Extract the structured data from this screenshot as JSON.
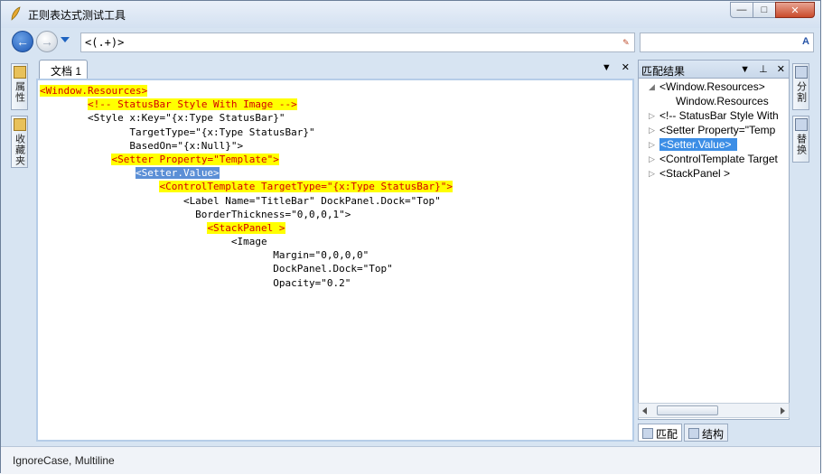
{
  "window": {
    "title": "正则表达式测试工具",
    "controls": {
      "minimize": "—",
      "maximize": "□",
      "close": "✕"
    }
  },
  "toolbar": {
    "back_label": "←",
    "forward_label": "→",
    "regex_value": "<(.+)>",
    "replace_value": ""
  },
  "left_sidebar": {
    "tabs": [
      {
        "label": "属性",
        "icon": "properties-icon"
      },
      {
        "label": "收藏夹",
        "icon": "favorites-icon"
      }
    ]
  },
  "document": {
    "tab_label": "文档 1",
    "tab_menu": "▼",
    "tab_close": "✕",
    "lines": [
      [
        {
          "t": "<Window.Resources>",
          "h": "y"
        }
      ],
      [
        {
          "t": "        "
        },
        {
          "t": "<!-- StatusBar Style With Image -->",
          "h": "y"
        }
      ],
      [
        {
          "t": "        <Style x:Key=\"{x:Type StatusBar}\""
        }
      ],
      [
        {
          "t": "               TargetType=\"{x:Type StatusBar}\""
        }
      ],
      [
        {
          "t": "               BasedOn=\"{x:Null}\">"
        }
      ],
      [
        {
          "t": "            "
        },
        {
          "t": "<Setter Property=\"Template\">",
          "h": "y"
        }
      ],
      [
        {
          "t": "                "
        },
        {
          "t": "<Setter.Value>",
          "h": "b"
        }
      ],
      [
        {
          "t": "                    "
        },
        {
          "t": "<ControlTemplate TargetType=\"{x:Type StatusBar}\">",
          "h": "y"
        }
      ],
      [
        {
          "t": "                        <Label Name=\"TitleBar\" DockPanel.Dock=\"Top\""
        }
      ],
      [
        {
          "t": "                          BorderThickness=\"0,0,0,1\">"
        }
      ],
      [
        {
          "t": "                            "
        },
        {
          "t": "<StackPanel >",
          "h": "y"
        }
      ],
      [
        {
          "t": "                                <Image"
        }
      ],
      [
        {
          "t": "                                       Margin=\"0,0,0,0\""
        }
      ],
      [
        {
          "t": "                                       DockPanel.Dock=\"Top\""
        }
      ],
      [
        {
          "t": "                                       Opacity=\"0.2\""
        }
      ]
    ]
  },
  "match_panel": {
    "title": "匹配结果",
    "controls": {
      "menu": "▼",
      "pin": "⊥",
      "close": "✕"
    },
    "results": [
      {
        "label": "<Window.Resources>",
        "expanded": true,
        "selected": false
      },
      {
        "label": "Window.Resources",
        "child": true,
        "selected": false
      },
      {
        "label": "<!-- StatusBar Style With",
        "expanded": false,
        "selected": false
      },
      {
        "label": "<Setter Property=\"Temp",
        "expanded": false,
        "selected": false
      },
      {
        "label": "<Setter.Value>",
        "expanded": false,
        "selected": true
      },
      {
        "label": "<ControlTemplate Target",
        "expanded": false,
        "selected": false
      },
      {
        "label": "<StackPanel >",
        "expanded": false,
        "selected": false
      }
    ],
    "bottom_tabs": [
      {
        "label": "匹配",
        "active": true
      },
      {
        "label": "结构",
        "active": false
      }
    ]
  },
  "right_sidebar": {
    "tabs": [
      {
        "label": "分割",
        "icon": "split-icon"
      },
      {
        "label": "替换",
        "icon": "replace-icon"
      }
    ]
  },
  "status": {
    "text": "IgnoreCase, Multiline"
  },
  "colors": {
    "highlight_yellow": "#ffff00",
    "highlight_text": "#d40000",
    "selection_blue": "#5b8fd6",
    "tree_selection": "#3c8ee6"
  }
}
